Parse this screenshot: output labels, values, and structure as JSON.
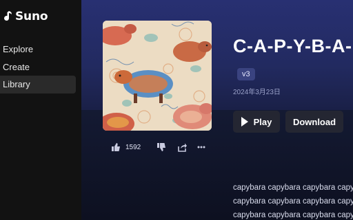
{
  "app": {
    "name": "Suno"
  },
  "sidebar": {
    "items": [
      {
        "label": "Explore",
        "active": false
      },
      {
        "label": "Create",
        "active": false
      },
      {
        "label": "Library",
        "active": true
      }
    ]
  },
  "song": {
    "title": "C-A-P-Y-B-A-",
    "version_badge": "v3",
    "date": "2024年3月23日",
    "likes": "1592",
    "play_label": "Play",
    "download_label": "Download",
    "lyrics": [
      "capybara capybara capybara capy",
      "capybara capybara capybara capy",
      "capybara capybara capybara capy"
    ]
  },
  "colors": {
    "sidebar_bg": "#121212",
    "hero_bg": "#283072",
    "button_bg": "#242632",
    "badge_bg": "#3a4380"
  },
  "icons": [
    "suno-logo-icon",
    "play-icon",
    "thumbs-up-icon",
    "thumbs-down-icon",
    "share-icon",
    "more-icon"
  ]
}
